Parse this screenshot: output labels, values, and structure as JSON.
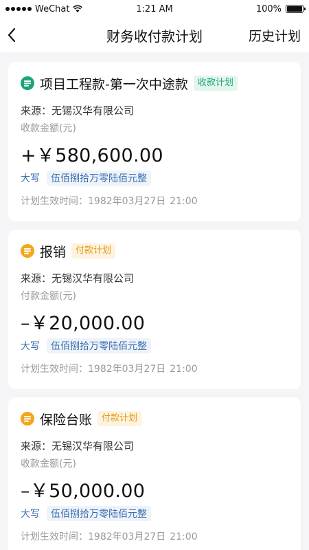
{
  "status_bar": {
    "carrier": "WeChat",
    "time": "1:21 AM",
    "battery": "100%",
    "battery_level": 1.0
  },
  "nav": {
    "title": "财务收付款计划",
    "history_label": "历史计划"
  },
  "colors": {
    "receive_icon": "#1aa672",
    "pay_icon": "#f4a61d",
    "tag_green": "#1aa672",
    "tag_orange": "#e59a17",
    "capital_blue": "#3b6fb0"
  },
  "cards": [
    {
      "title": "项目工程款-第一次中途款",
      "tag": "收款计划",
      "tag_type": "green",
      "icon": "receive-icon",
      "source_label": "来源：",
      "source": "无锡汉华有限公司",
      "amount_label": "收款金额(元)",
      "amount": "+￥580,600.00",
      "capital_label": "大写",
      "capital_value": "伍佰捌拾万零陆佰元整",
      "time_label": "计划生效时间：",
      "time_date": "1982年03月27日",
      "time_clock": "21:00"
    },
    {
      "title": "报销",
      "tag": "付款计划",
      "tag_type": "orange",
      "icon": "pay-icon",
      "source_label": "来源：",
      "source": "无锡汉华有限公司",
      "amount_label": "付款金额(元)",
      "amount": "–￥20,000.00",
      "capital_label": "大写",
      "capital_value": "伍佰捌拾万零陆佰元整",
      "time_label": "计划生效时间：",
      "time_date": "1982年03月27日",
      "time_clock": "21:00"
    },
    {
      "title": "保险台账",
      "tag": "付款计划",
      "tag_type": "orange",
      "icon": "pay-icon",
      "source_label": "来源：",
      "source": "无锡汉华有限公司",
      "amount_label": "收款金额(元)",
      "amount": "–￥50,000.00",
      "capital_label": "大写",
      "capital_value": "伍佰捌拾万零陆佰元整",
      "time_label": "计划生效时间：",
      "time_date": "1982年03月27日",
      "time_clock": "21:00"
    }
  ]
}
